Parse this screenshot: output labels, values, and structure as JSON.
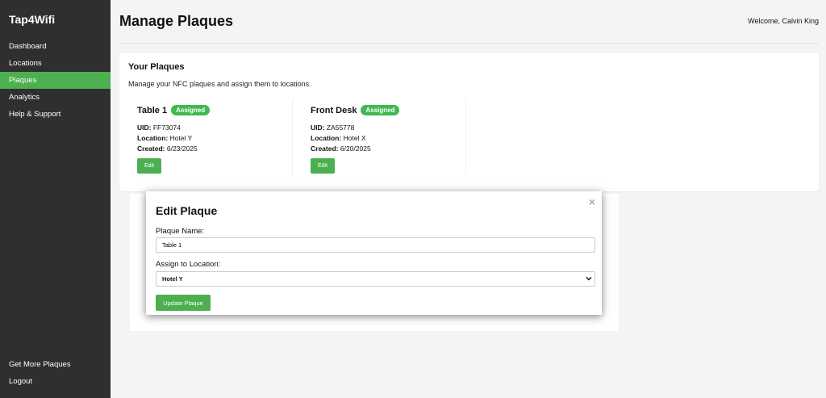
{
  "sidebar": {
    "brand": "Tap4Wifi",
    "items": [
      {
        "label": "Dashboard"
      },
      {
        "label": "Locations"
      },
      {
        "label": "Plaques"
      },
      {
        "label": "Analytics"
      },
      {
        "label": "Help & Support"
      }
    ],
    "bottom_items": [
      {
        "label": "Get More Plaques"
      },
      {
        "label": "Logout"
      }
    ],
    "active_color": "#4caf50"
  },
  "header": {
    "title": "Manage Plaques",
    "welcome": "Welcome, Calvin King"
  },
  "panel": {
    "title": "Your Plaques",
    "description": "Manage your NFC plaques and assign them to locations.",
    "uid_label": "UID:",
    "location_label": "Location:",
    "created_label": "Created:",
    "edit_label": "Edit",
    "plaques": [
      {
        "name": "Table 1",
        "status": "Assigned",
        "uid": "FF73074",
        "location": "Hotel Y",
        "created": "6/23/2025"
      },
      {
        "name": "Front Desk",
        "status": "Assigned",
        "uid": "ZA55778",
        "location": "Hotel X",
        "created": "6/20/2025"
      }
    ]
  },
  "modal": {
    "title": "Edit Plaque",
    "close_symbol": "×",
    "name_label": "Plaque Name:",
    "name_value": "Table 1",
    "location_label": "Assign to Location:",
    "location_value": "Hotel Y",
    "submit_label": "Update Plaque"
  }
}
